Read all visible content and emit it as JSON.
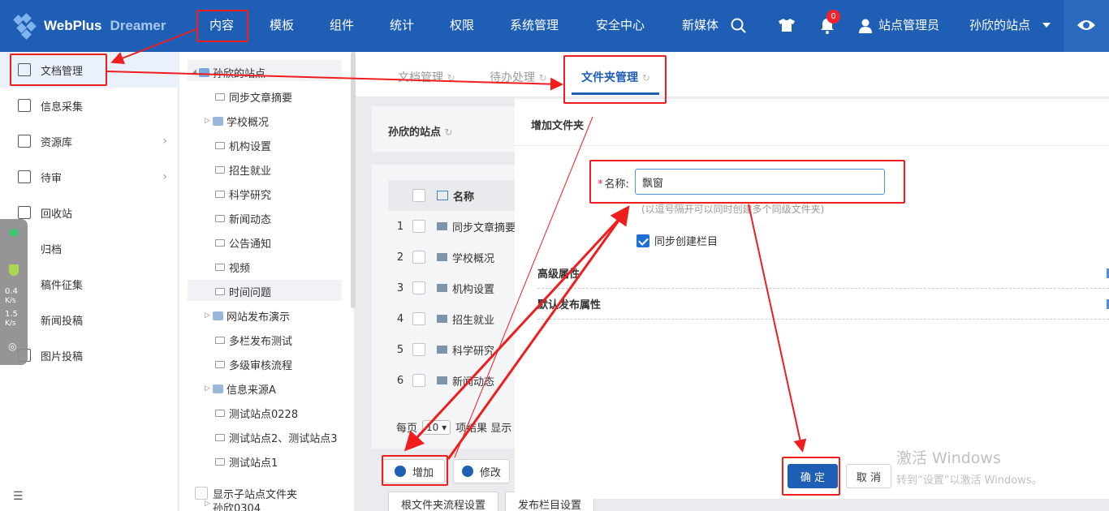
{
  "brand": {
    "name": "WebPlus",
    "sub": "Dreamer"
  },
  "nav": {
    "items": [
      "内容",
      "模板",
      "组件",
      "统计",
      "权限",
      "系统管理",
      "安全中心",
      "新媒体"
    ],
    "notification_count": "0",
    "user": "站点管理员",
    "site": "孙欣的站点"
  },
  "sidebar": {
    "items": [
      "文档管理",
      "信息采集",
      "资源库",
      "待审",
      "回收站",
      "归档",
      "稿件征集",
      "新闻投稿",
      "图片投稿"
    ]
  },
  "speed": {
    "up": "0.4",
    "up_unit": "K/s",
    "down": "1.5",
    "down_unit": "K/s"
  },
  "tree": {
    "root": "孙欣的站点",
    "nodes": [
      "同步文章摘要",
      "学校概况",
      "机构设置",
      "招生就业",
      "科学研究",
      "新闻动态",
      "公告通知",
      "视频",
      "时间问题",
      "网站发布演示",
      "多栏发布测试",
      "多级审核流程",
      "信息来源A",
      "测试站点0228",
      "测试站点2、测试站点3",
      "测试站点1",
      "孙欣0304"
    ],
    "show_child_label": "显示子站点文件夹"
  },
  "tabs": [
    "文档管理",
    "待办处理",
    "文件夹管理"
  ],
  "main": {
    "card_title": "孙欣的站点",
    "col_name": "名称",
    "rows": [
      {
        "num": "1",
        "name": "同步文章摘要"
      },
      {
        "num": "2",
        "name": "学校概况"
      },
      {
        "num": "3",
        "name": "机构设置"
      },
      {
        "num": "4",
        "name": "招生就业"
      },
      {
        "num": "5",
        "name": "科学研究"
      },
      {
        "num": "6",
        "name": "新闻动态"
      }
    ],
    "pager_prefix": "每页",
    "page_size": "10",
    "pager_suffix": "项结果 显示",
    "btn_add": "增加",
    "btn_edit": "修改",
    "btn_root_flow": "根文件夹流程设置",
    "btn_publish_col": "发布栏目设置"
  },
  "modal": {
    "title": "增加文件夹",
    "name_label": "名称:",
    "name_value": "飘窗",
    "hint": "(以逗号隔开可以同时创建多个同级文件夹)",
    "sync_label": "同步创建栏目",
    "sections": [
      "高级属性",
      "默认发布属性"
    ],
    "btn_ok": "确 定",
    "btn_cancel": "取 消"
  },
  "watermark": {
    "line1": "激活 Windows",
    "line2": "转到“设置”以激活 Windows。"
  }
}
